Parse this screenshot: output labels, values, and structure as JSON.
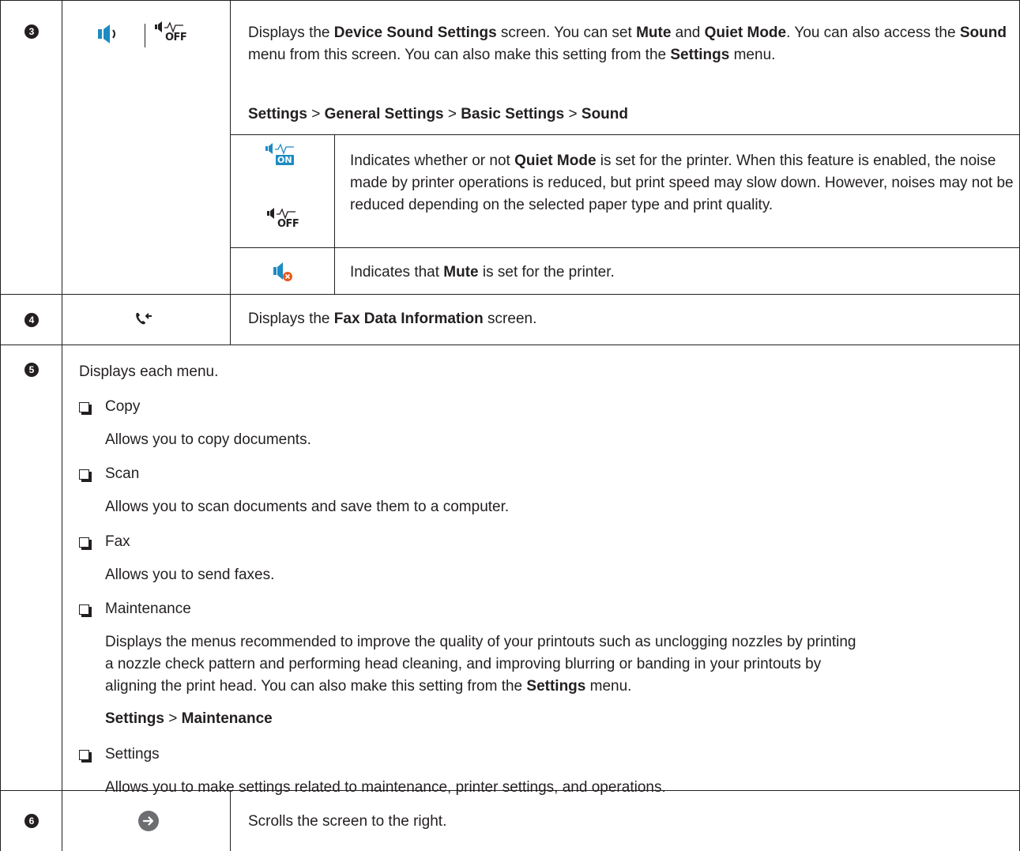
{
  "rows": {
    "r3": {
      "number": "3",
      "description_parts": [
        "Displays the ",
        "Device Sound Settings",
        " screen. You can set ",
        "Mute",
        " and ",
        "Quiet Mode",
        ". You can also access the ",
        "Sound",
        " menu from this screen. You can also make this setting from the ",
        "Settings",
        " menu."
      ],
      "path": [
        "Settings",
        "General Settings",
        "Basic Settings",
        "Sound"
      ],
      "path_sep": ">",
      "sub_quiet_parts": [
        "Indicates whether or not ",
        "Quiet Mode",
        " is set for the printer. When this feature is enabled, the noise made by printer operations is reduced, but print speed may slow down. However, noises may not be reduced depending on the selected paper type and print quality."
      ],
      "sub_mute_parts": [
        "Indicates that ",
        "Mute",
        " is set for the printer."
      ],
      "icon_on_label": "ON",
      "icon_off_label": "OFF"
    },
    "r4": {
      "number": "4",
      "description_parts": [
        "Displays the ",
        "Fax Data Information",
        " screen."
      ]
    },
    "r5": {
      "number": "5",
      "intro": "Displays each menu.",
      "items": [
        {
          "name": "Copy",
          "desc": "Allows you to copy documents."
        },
        {
          "name": "Scan",
          "desc": "Allows you to scan documents and save them to a computer."
        },
        {
          "name": "Fax",
          "desc": "Allows you to send faxes."
        },
        {
          "name": "Maintenance",
          "desc_lines": [
            "Displays the menus recommended to improve the quality of your printouts such as unclogging nozzles by printing",
            "a nozzle check pattern and performing head cleaning, and improving blurring or banding in your printouts by",
            "aligning the print head. You can also make this setting from the "
          ],
          "desc_bold": "Settings",
          "desc_tail": " menu.",
          "path": [
            "Settings",
            "Maintenance"
          ]
        },
        {
          "name": "Settings",
          "desc": "Allows you to make settings related to maintenance, printer settings, and operations."
        }
      ]
    },
    "r6": {
      "number": "6",
      "description": "Scrolls the screen to the right."
    }
  },
  "colors": {
    "rule": "#231f20",
    "icon_blue": "#1e8bc3",
    "mute_badge": "#e8591a",
    "scroll_circle": "#6d6e71"
  },
  "icons": {
    "speaker": "speaker-icon",
    "quiet_off": "quiet-mode-off-icon",
    "quiet_on": "quiet-mode-on-icon",
    "mute": "mute-icon",
    "fax_data": "fax-data-icon",
    "scroll_right": "scroll-right-icon"
  }
}
